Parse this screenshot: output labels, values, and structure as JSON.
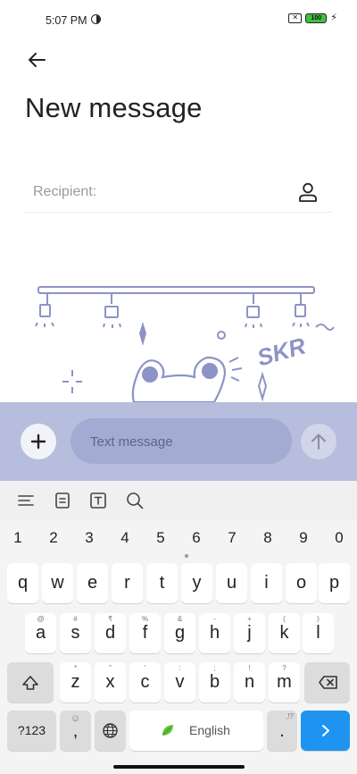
{
  "status_bar": {
    "time": "5:07 PM",
    "battery": "100",
    "sim_status": "✕"
  },
  "header": {
    "title": "New message"
  },
  "recipient": {
    "placeholder": "Recipient:"
  },
  "illustration": {
    "text": "SKR"
  },
  "compose": {
    "placeholder": "Text message"
  },
  "keyboard": {
    "number_row": [
      "1",
      "2",
      "3",
      "4",
      "5",
      "6",
      "7",
      "8",
      "9",
      "0"
    ],
    "row1": [
      "q",
      "w",
      "e",
      "r",
      "t",
      "y",
      "u",
      "i",
      "o",
      "p"
    ],
    "row2": [
      {
        "key": "a",
        "hint": "@"
      },
      {
        "key": "s",
        "hint": "#"
      },
      {
        "key": "d",
        "hint": "₹"
      },
      {
        "key": "f",
        "hint": "%"
      },
      {
        "key": "g",
        "hint": "&"
      },
      {
        "key": "h",
        "hint": "-"
      },
      {
        "key": "j",
        "hint": "+"
      },
      {
        "key": "k",
        "hint": "("
      },
      {
        "key": "l",
        "hint": ")"
      }
    ],
    "row3": [
      {
        "key": "z",
        "hint": "*"
      },
      {
        "key": "x",
        "hint": "\""
      },
      {
        "key": "c",
        "hint": "'"
      },
      {
        "key": "v",
        "hint": ":"
      },
      {
        "key": "b",
        "hint": ";"
      },
      {
        "key": "n",
        "hint": "!"
      },
      {
        "key": "m",
        "hint": "?"
      }
    ],
    "symbols_label": "?123",
    "comma_label": ",",
    "space_label": "English",
    "period_label": ".",
    "period_hint": ",!?"
  }
}
